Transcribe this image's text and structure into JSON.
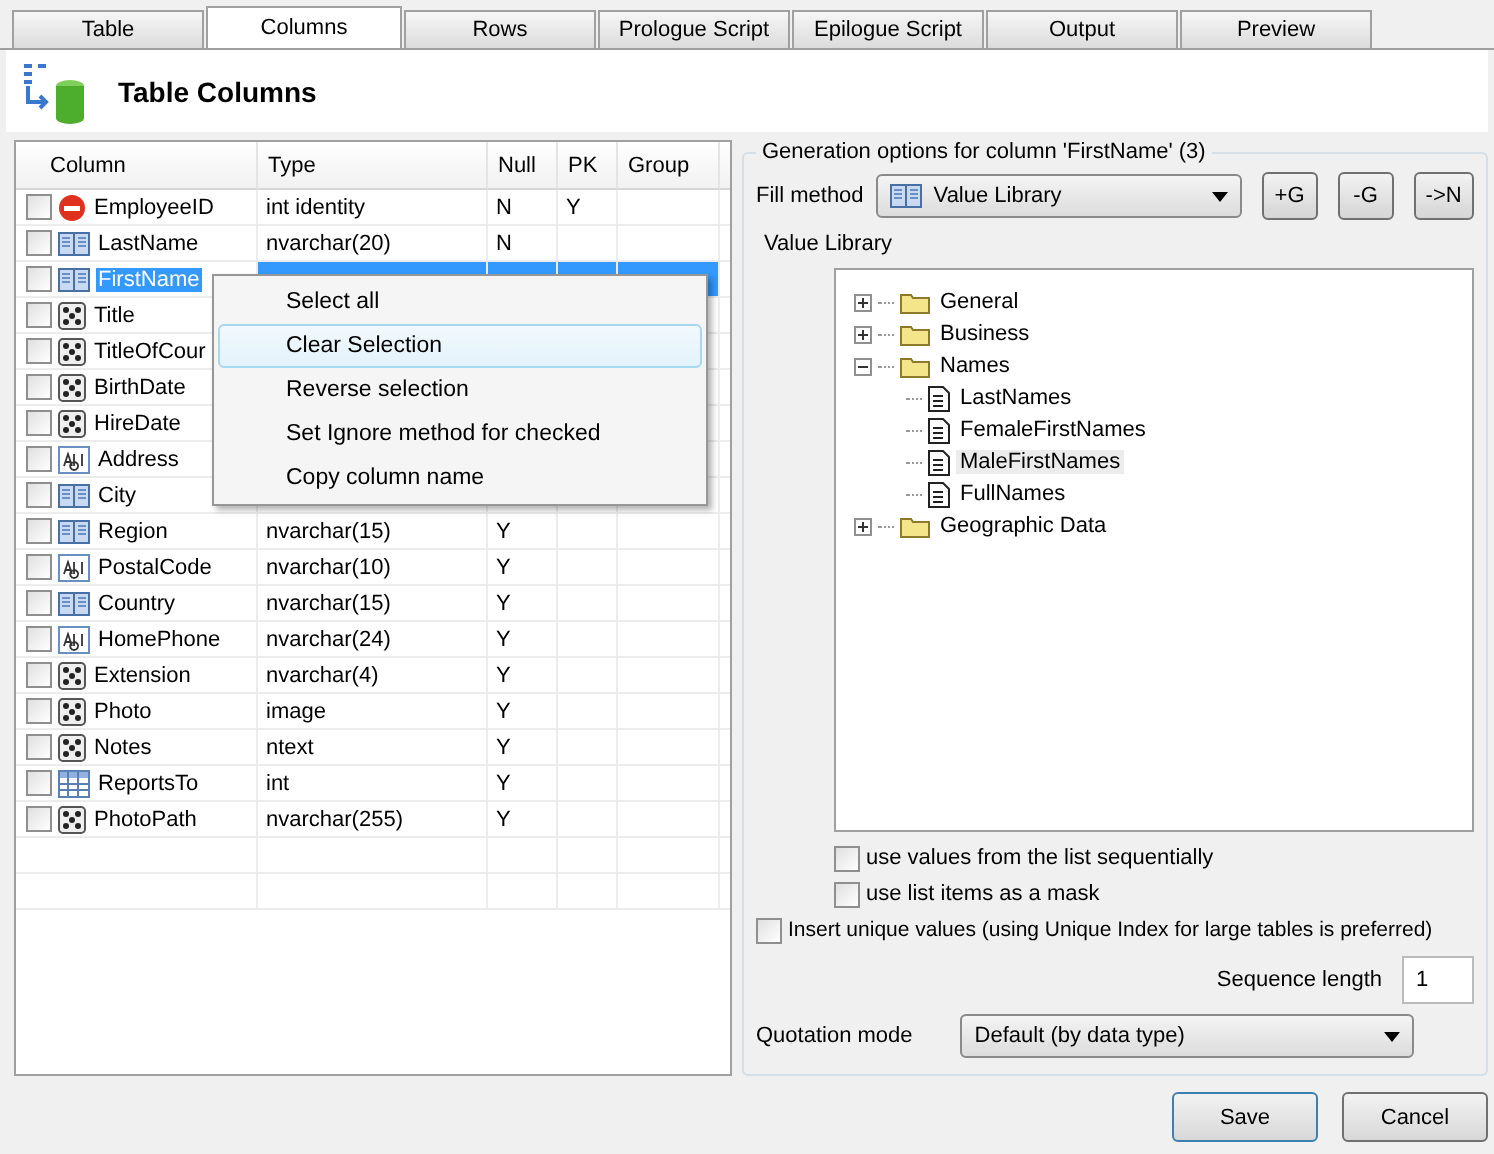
{
  "tabs": [
    {
      "label": "Table",
      "selected": false
    },
    {
      "label": "Columns",
      "selected": true
    },
    {
      "label": "Rows",
      "selected": false
    },
    {
      "label": "Prologue Script",
      "selected": false
    },
    {
      "label": "Epilogue Script",
      "selected": false
    },
    {
      "label": "Output",
      "selected": false
    },
    {
      "label": "Preview",
      "selected": false
    }
  ],
  "header": {
    "title": "Table Columns"
  },
  "table": {
    "columns": [
      "Column",
      "Type",
      "Null",
      "PK",
      "Group"
    ],
    "rows": [
      {
        "checked": false,
        "kind": "stop",
        "name": "EmployeeID",
        "type": "int identity",
        "null": "N",
        "pk": "Y",
        "selected": false
      },
      {
        "checked": false,
        "kind": "book",
        "name": "LastName",
        "type": "nvarchar(20)",
        "null": "N",
        "selected": false
      },
      {
        "checked": false,
        "kind": "book",
        "name": "FirstName",
        "selected": true
      },
      {
        "checked": false,
        "kind": "dice",
        "name": "Title",
        "selected": false
      },
      {
        "checked": false,
        "kind": "dice",
        "name": "TitleOfCour",
        "selected": false
      },
      {
        "checked": false,
        "kind": "dice",
        "name": "BirthDate",
        "selected": false
      },
      {
        "checked": false,
        "kind": "dice",
        "name": "HireDate",
        "selected": false
      },
      {
        "checked": false,
        "kind": "abl",
        "name": "Address",
        "selected": false
      },
      {
        "checked": false,
        "kind": "book",
        "name": "City",
        "selected": false
      },
      {
        "checked": false,
        "kind": "book",
        "name": "Region",
        "type": "nvarchar(15)",
        "null": "Y",
        "selected": false
      },
      {
        "checked": false,
        "kind": "abl",
        "name": "PostalCode",
        "type": "nvarchar(10)",
        "null": "Y",
        "selected": false
      },
      {
        "checked": false,
        "kind": "book",
        "name": "Country",
        "type": "nvarchar(15)",
        "null": "Y",
        "selected": false
      },
      {
        "checked": false,
        "kind": "abl",
        "name": "HomePhone",
        "type": "nvarchar(24)",
        "null": "Y",
        "selected": false
      },
      {
        "checked": false,
        "kind": "dice",
        "name": "Extension",
        "type": "nvarchar(4)",
        "null": "Y",
        "selected": false
      },
      {
        "checked": false,
        "kind": "dice",
        "name": "Photo",
        "type": "image",
        "null": "Y",
        "selected": false
      },
      {
        "checked": false,
        "kind": "dice",
        "name": "Notes",
        "type": "ntext",
        "null": "Y",
        "selected": false
      },
      {
        "checked": false,
        "kind": "grid",
        "name": "ReportsTo",
        "type": "int",
        "null": "Y",
        "selected": false
      },
      {
        "checked": false,
        "kind": "dice",
        "name": "PhotoPath",
        "type": "nvarchar(255)",
        "null": "Y",
        "selected": false
      }
    ]
  },
  "context_menu": {
    "items": [
      {
        "label": "Select all",
        "selected": false
      },
      {
        "label": "Clear Selection",
        "selected": true
      },
      {
        "label": "Reverse selection",
        "selected": false
      },
      {
        "label": "Set Ignore method for checked",
        "selected": false
      },
      {
        "label": "Copy column name",
        "selected": false
      }
    ]
  },
  "options": {
    "title": "Generation options for column 'FirstName' (3)",
    "fill_method_label": "Fill method",
    "fill_method": "Value Library",
    "buttons": [
      "+G",
      "-G",
      "->N"
    ],
    "library_label": "Value Library",
    "tree": [
      {
        "label": "General",
        "kind": "folder",
        "expanded": false,
        "selected": false
      },
      {
        "label": "Business",
        "kind": "folder",
        "expanded": false,
        "selected": false
      },
      {
        "label": "Names",
        "kind": "folder",
        "expanded": true,
        "selected": false,
        "children": [
          {
            "label": "LastNames",
            "kind": "file",
            "selected": false
          },
          {
            "label": "FemaleFirstNames",
            "kind": "file",
            "selected": false
          },
          {
            "label": "MaleFirstNames",
            "kind": "file",
            "selected": true
          },
          {
            "label": "FullNames",
            "kind": "file",
            "selected": false
          }
        ]
      },
      {
        "label": "Geographic Data",
        "kind": "folder",
        "expanded": false,
        "selected": false
      }
    ],
    "sequential": {
      "label": "use values from the list sequentially",
      "checked": false
    },
    "mask": {
      "label": "use list items as a mask",
      "checked": false
    },
    "unique": {
      "label": "Insert unique values (using Unique Index for large tables is preferred)",
      "checked": false
    },
    "sequence_label": "Sequence length",
    "sequence_value": "1",
    "quotation_label": "Quotation mode",
    "quotation_value": "Default (by data type)"
  },
  "footer": {
    "buttons": [
      "Save",
      "Cancel"
    ]
  }
}
